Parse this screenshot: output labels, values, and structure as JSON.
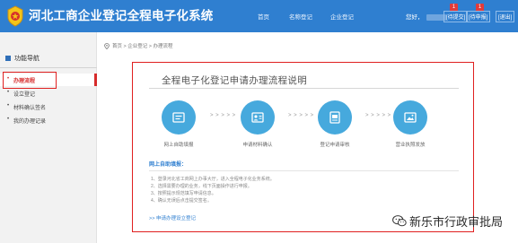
{
  "header": {
    "title": "河北工商企业登记全程电子化系统",
    "nav": [
      "首页",
      "名称登记",
      "企业登记"
    ],
    "greeting": "您好，",
    "todo_label": "[待提交]",
    "todo_count": "1",
    "cancel_label": "[待申报]",
    "cancel_count": "1",
    "exit_label": "[退出]"
  },
  "sidebar": {
    "heading": "功能导航",
    "items": [
      {
        "label": "办理流程",
        "active": true
      },
      {
        "label": "设立登记",
        "active": false
      },
      {
        "label": "材料确认签名",
        "active": false
      },
      {
        "label": "我的办理记录",
        "active": false
      }
    ]
  },
  "breadcrumb": "首页 > 企业登记 > 办理流程",
  "main": {
    "title": "全程电子化登记申请办理流程说明",
    "arrows": "> > > > >",
    "steps": [
      {
        "label": "网上自助填报",
        "icon": "form-icon"
      },
      {
        "label": "申请材料确认",
        "icon": "id-card-icon"
      },
      {
        "label": "登记申请审核",
        "icon": "review-icon"
      },
      {
        "label": "营业执照发放",
        "icon": "license-icon"
      }
    ],
    "section_title": "网上自助填报：",
    "instructions": [
      "1、登录河北省工商网上办事大厅，进入全程电子化业务系统。",
      "2、选择需要办理的业务，线下页面操作进行申报。",
      "3、按照提示规范填写申请信息。",
      "4、确认无误后点击提交签名。"
    ],
    "link": ">> 申请办理设立登记"
  },
  "watermark": "新乐市行政审批局",
  "colors": {
    "header_bg": "#2f7fd0",
    "step_circle": "#46a9dd",
    "highlight": "#e02020"
  }
}
